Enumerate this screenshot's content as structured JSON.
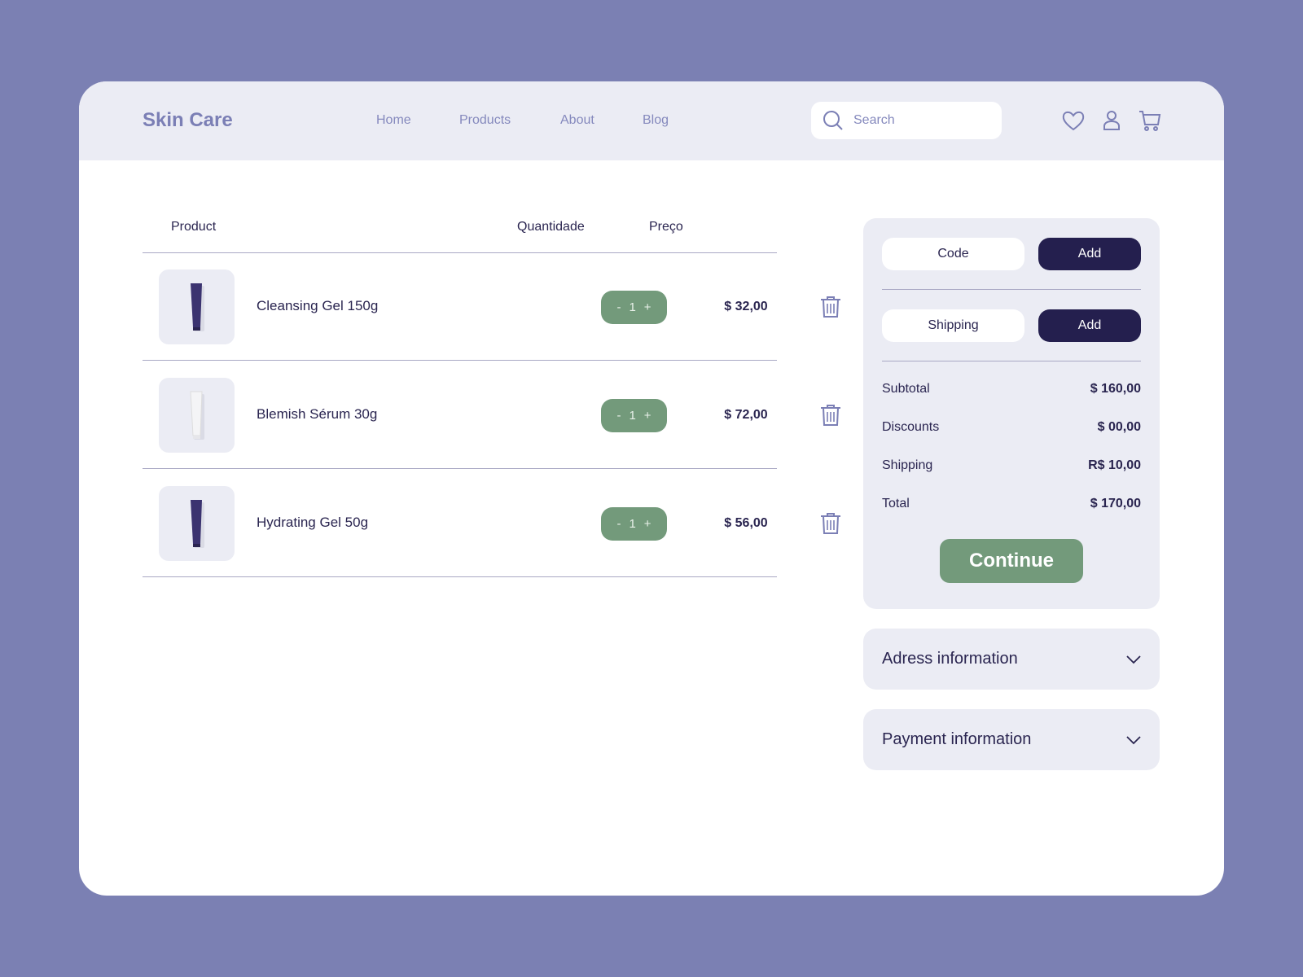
{
  "header": {
    "logo": "Skin Care",
    "nav": [
      "Home",
      "Products",
      "About",
      "Blog"
    ],
    "search_placeholder": "Search"
  },
  "table": {
    "headers": {
      "product": "Product",
      "quantity": "Quantidade",
      "price": "Preço"
    },
    "rows": [
      {
        "name": "Cleansing Gel 150g",
        "qty": "1",
        "price": "$ 32,00",
        "tube_color": "#3b3370"
      },
      {
        "name": "Blemish Sérum 30g",
        "qty": "1",
        "price": "$ 72,00",
        "tube_color": "#f4f4f6"
      },
      {
        "name": "Hydrating Gel 50g",
        "qty": "1",
        "price": "$ 56,00",
        "tube_color": "#3b3370"
      }
    ],
    "minus": "-",
    "plus": "+"
  },
  "summary": {
    "code_label": "Code",
    "shipping_label": "Shipping",
    "add_label": "Add",
    "lines": [
      {
        "label": "Subtotal",
        "value": "$ 160,00"
      },
      {
        "label": "Discounts",
        "value": "$ 00,00"
      },
      {
        "label": "Shipping",
        "value": "R$ 10,00"
      },
      {
        "label": "Total",
        "value": "$ 170,00"
      }
    ],
    "continue": "Continue"
  },
  "accordions": [
    "Adress information",
    "Payment information"
  ],
  "colors": {
    "accent": "#739a7b",
    "dark": "#241f4e",
    "brand": "#7b7fb5"
  }
}
